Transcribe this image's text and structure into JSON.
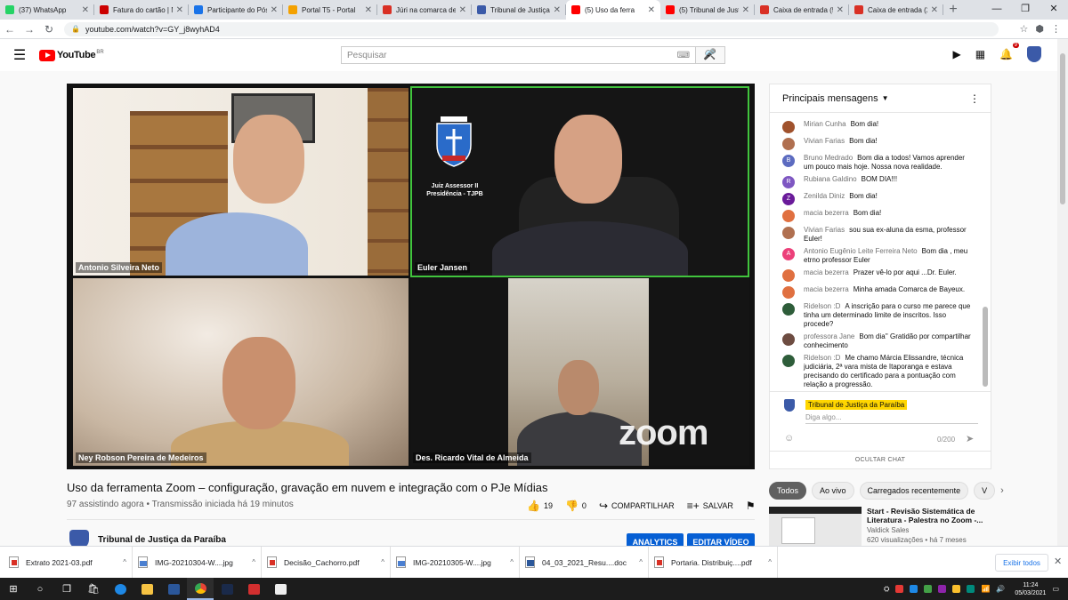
{
  "browser": {
    "tabs": [
      {
        "title": "(37) WhatsApp",
        "color": "#25d366"
      },
      {
        "title": "Fatura do cartão | Nubank",
        "color": "#cc0000"
      },
      {
        "title": "Participante do Pós",
        "color": "#1a73e8"
      },
      {
        "title": "Portal T5 - Portal",
        "color": "#f4a100"
      },
      {
        "title": "Júri na comarca de",
        "color": "#d93025"
      },
      {
        "title": "Tribunal de Justiça",
        "color": "#3b5aa8"
      },
      {
        "title": "(5) Uso da ferra",
        "color": "#ff0000",
        "active": true
      },
      {
        "title": "(5) Tribunal de Justiça",
        "color": "#ff0000"
      },
      {
        "title": "Caixa de entrada (5)",
        "color": "#d93025"
      },
      {
        "title": "Caixa de entrada (2)",
        "color": "#d93025"
      }
    ],
    "new_tab": "+",
    "url": "youtube.com/watch?v=GY_j8wyhAD4"
  },
  "youtube": {
    "logo_text": "YouTube",
    "logo_country": "BR",
    "search_placeholder": "Pesquisar",
    "notification_count": "9"
  },
  "video": {
    "participants": [
      {
        "name": "Antonio Silveira Neto"
      },
      {
        "name": "Euler Jansen"
      },
      {
        "name": "Ney Robson Pereira de Medeiros"
      },
      {
        "name": "Des. Ricardo Vital de Almeida"
      }
    ],
    "crest_text_1": "Juiz Assessor II",
    "crest_text_2": "Presidência - TJPB",
    "zoom_watermark": "zoom",
    "title": "Uso da ferramenta Zoom – configuração, gravação em nuvem e integração com o PJe Mídias",
    "meta": "97 assistindo agora • Transmissão iniciada há 19 minutos",
    "likes": "19",
    "dislikes": "0",
    "share_label": "COMPARTILHAR",
    "save_label": "SALVAR",
    "channel_name": "Tribunal de Justiça da Paraíba",
    "analytics_label": "ANALYTICS",
    "edit_label": "EDITAR VÍDEO"
  },
  "chat": {
    "header": "Principais mensagens",
    "messages": [
      {
        "author": "Mirian Cunha",
        "text": "Bom dia!",
        "color": "#a0522d"
      },
      {
        "author": "Vivian Farias",
        "text": "Bom dia!",
        "color": "#b07050"
      },
      {
        "author": "Bruno Medrado",
        "text": "Bom dia a todos! Vamos aprender um pouco mais hoje. Nossa nova realidade.",
        "color": "#5c6bc0",
        "initial": "B"
      },
      {
        "author": "Rubiana Galdino",
        "text": "BOM DIA!!!",
        "color": "#7e57c2",
        "initial": "R"
      },
      {
        "author": "Zenilda Diniz",
        "text": "Bom dia!",
        "color": "#6a1b9a",
        "initial": "Z"
      },
      {
        "author": "macia bezerra",
        "text": "Bom dia!",
        "color": "#e07040"
      },
      {
        "author": "Vivian Farias",
        "text": "sou sua ex-aluna da esma, professor Euler!",
        "color": "#b07050"
      },
      {
        "author": "Antonio Eugênio Leite Ferreira Neto",
        "text": "Bom dia , meu etrno professor Euler",
        "color": "#ec407a",
        "initial": "A"
      },
      {
        "author": "macia bezerra",
        "text": "Prazer vê-lo por aqui ...Dr. Euler.",
        "color": "#e07040"
      },
      {
        "author": "macia bezerra",
        "text": "Minha amada Comarca de Bayeux.",
        "color": "#e07040"
      },
      {
        "author": "Ridelson :D",
        "text": "A inscrição para o curso me parece que tinha um determinado limite de inscritos. Isso procede?",
        "color": "#2e5d3a"
      },
      {
        "author": "professora Jane",
        "text": "Bom dia'' Gratidão por compartilhar conhecimento",
        "color": "#6d4c41"
      },
      {
        "author": "Ridelson :D",
        "text": "Me chamo Márcia Elissandre, técnica judiciária, 2ª vara mista de Itaporanga e estava precisando do certificado para a pontuação com relação a progressão.",
        "color": "#2e5d3a"
      }
    ],
    "input_user": "Tribunal de Justiça da Paraíba",
    "input_placeholder": "Diga algo...",
    "char_count": "0/200",
    "hide_label": "OCULTAR CHAT"
  },
  "chips": [
    "Todos",
    "Ao vivo",
    "Carregados recentemente",
    "V"
  ],
  "recommended": {
    "title": "Start - Revisão Sistemática de Literatura - Palestra no Zoom -...",
    "channel": "Valdick Sales",
    "views": "620 visualizações • há 7 meses"
  },
  "downloads": {
    "items": [
      {
        "name": "Extrato 2021-03.pdf",
        "type": "pdf"
      },
      {
        "name": "IMG-20210304-W....jpg",
        "type": "img"
      },
      {
        "name": "Decisão_Cachorro.pdf",
        "type": "pdf"
      },
      {
        "name": "IMG-20210305-W....jpg",
        "type": "img"
      },
      {
        "name": "04_03_2021_Resu....doc",
        "type": "doc"
      },
      {
        "name": "Portaria. Distribuiç....pdf",
        "type": "pdf"
      }
    ],
    "show_all": "Exibir todos"
  },
  "taskbar": {
    "time": "11:24",
    "date": "05/03/2021"
  }
}
